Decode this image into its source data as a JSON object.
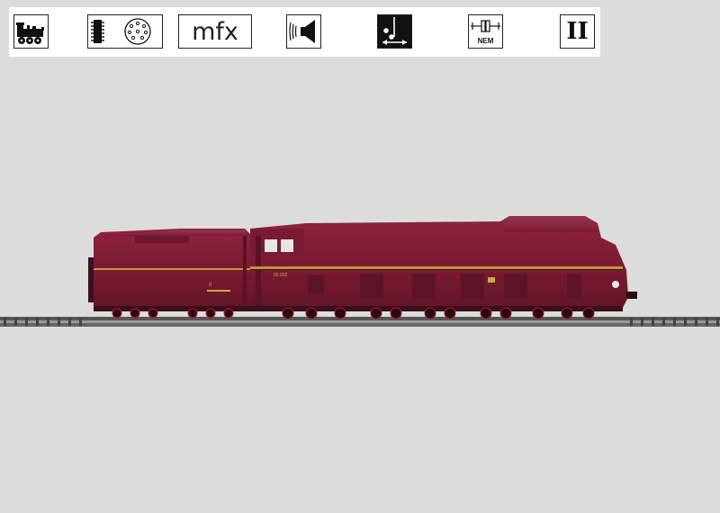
{
  "icon_bar": {
    "icons": [
      {
        "name": "steam-locomotive-icon"
      },
      {
        "name": "digital-decoder-icon"
      },
      {
        "name": "mfx-logo",
        "label": "mfx"
      },
      {
        "name": "sound-speaker-icon"
      },
      {
        "name": "light-change-direction-icon"
      },
      {
        "name": "nem-coupler-icon",
        "label": "NEM"
      },
      {
        "name": "gauge-icon",
        "label": "II"
      }
    ]
  },
  "product": {
    "name": "streamlined-steam-locomotive",
    "body_color": "#7d1b33",
    "stripe_color": "#b89a3e"
  }
}
